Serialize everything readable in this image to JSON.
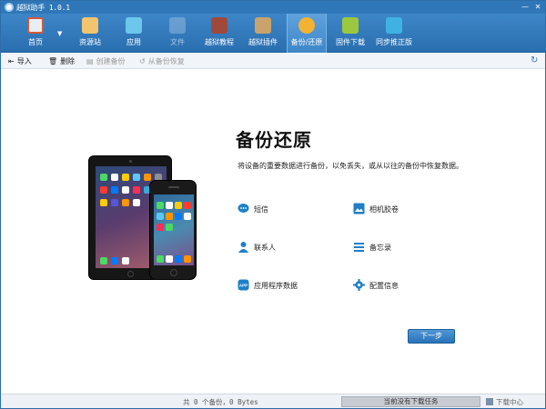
{
  "window": {
    "title": "越狱助手 1.0.1",
    "minimize": "—",
    "close": "✕"
  },
  "toolbar": {
    "items": [
      {
        "label": "首页",
        "icon": "home-icon",
        "color": "#e9eef3",
        "active": false,
        "enabled": true
      },
      {
        "label": "资源站",
        "icon": "store-icon",
        "color": "#f2c46d",
        "active": false,
        "enabled": true
      },
      {
        "label": "应用",
        "icon": "apps-icon",
        "color": "#6cc7ea",
        "active": false,
        "enabled": true
      },
      {
        "label": "文件",
        "icon": "folder-icon",
        "color": "#8fb7dd",
        "active": false,
        "enabled": false
      },
      {
        "label": "越狱教程",
        "icon": "book-icon",
        "color": "#a0493a",
        "active": false,
        "enabled": true
      },
      {
        "label": "越狱插件",
        "icon": "plugin-icon",
        "color": "#c9a36b",
        "active": false,
        "enabled": true
      },
      {
        "label": "备份/还原",
        "icon": "backup-icon",
        "color": "#f2b233",
        "active": true,
        "enabled": true
      },
      {
        "label": "固件下载",
        "icon": "download-icon",
        "color": "#9cc83f",
        "active": false,
        "enabled": true
      },
      {
        "label": "同步推正版",
        "icon": "sync-icon",
        "color": "#3fb2e3",
        "active": false,
        "enabled": true
      }
    ]
  },
  "subbar": {
    "import": "导入",
    "delete": "删除",
    "create_backup": "创建备份",
    "restore_from_backup": "从备份恢复"
  },
  "main": {
    "title": "备份还原",
    "description": "将设备的重要数据进行备份，以免丢失，或从以往的备份中恢复数据。",
    "options": [
      {
        "label": "短信",
        "icon": "message-icon"
      },
      {
        "label": "相机胶卷",
        "icon": "photo-icon"
      },
      {
        "label": "联系人",
        "icon": "contact-icon"
      },
      {
        "label": "备忘录",
        "icon": "notes-icon"
      },
      {
        "label": "应用程序数据",
        "icon": "app-data-icon"
      },
      {
        "label": "配置信息",
        "icon": "settings-icon"
      }
    ],
    "next_button": "下一步"
  },
  "status": {
    "summary": "共 0 个备份，0 Bytes",
    "download_status": "当前没有下载任务",
    "download_center": "下载中心"
  },
  "colors": {
    "accent": "#2f77b8",
    "icon_blue": "#1e7fc9"
  }
}
